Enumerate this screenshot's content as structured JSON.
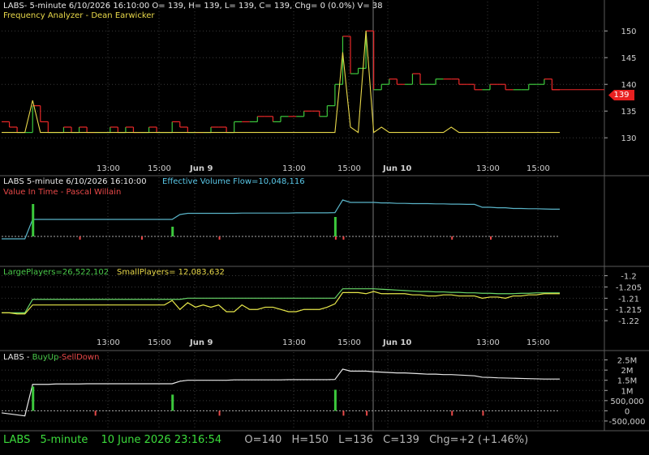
{
  "window": {
    "panel1_header": "LABS- 5-minute 6/10/2026 16:10:00 O= 139, H= 139, L= 139, C= 139, Chg= 0 (0.0%) V= 38",
    "panel1_indicator": "Frequency Analyzer - Dean Earwicker",
    "panel2_header": "LABS 5-minute  6/10/2026 16:10:00",
    "panel2_flow": "Effective Volume Flow=10,048,116",
    "panel2_indicator": "Value In Time - Pascal Willain",
    "panel3_large": "LargePlayers=26,522,102",
    "panel3_small": "SmallPlayers= 12,083,632",
    "panel4_symbol": "LABS - ",
    "panel4_buy": "BuyUp",
    "panel4_dash": "-",
    "panel4_sell": "SellDown",
    "price_tag": "139"
  },
  "footer": {
    "symbol": "LABS",
    "interval": "5-minute",
    "datetime": "10 June 2026 23:16:54",
    "open": "O=140",
    "high": "H=150",
    "low": "L=136",
    "close": "C=139",
    "change": "Chg=+2 (+1.46%)"
  },
  "colors": {
    "price_up": "#3cc83c",
    "price_down": "#e82828",
    "frequency": "#e8d84a",
    "evf_line": "#5ab4c8",
    "large_players": "#6ad86a",
    "small_players": "#e8e84a",
    "white_line": "#e8e8e8"
  },
  "chart_data": [
    {
      "type": "line",
      "panel": "price",
      "ylim": [
        127,
        152
      ],
      "y_ticks": [
        "130",
        "135",
        "140",
        "145",
        "150"
      ],
      "x_ticks": [
        "13:00",
        "15:00",
        "Jun 9",
        "13:00",
        "15:00",
        "Jun 10",
        "13:00",
        "15:00"
      ],
      "current_price": 139,
      "series": [
        {
          "values": [
            133,
            132,
            131,
            131,
            136,
            133,
            131,
            131,
            132,
            131,
            132,
            131,
            131,
            131,
            132,
            131,
            132,
            131,
            131,
            132,
            131,
            131,
            133,
            132,
            131,
            131,
            131,
            132,
            132,
            131,
            133,
            133,
            133,
            134,
            134,
            133,
            134,
            134,
            134,
            135,
            135,
            134,
            136,
            140,
            149,
            142,
            143,
            150,
            139,
            140,
            141,
            140,
            140,
            142,
            140,
            140,
            141,
            141,
            141,
            140,
            140,
            139,
            139,
            140,
            140,
            139,
            139,
            139,
            140,
            140,
            141,
            139,
            139
          ]
        },
        {
          "values": [
            131,
            131,
            131,
            131,
            137,
            131,
            131,
            131,
            131,
            131,
            131,
            131,
            131,
            131,
            131,
            131,
            131,
            131,
            131,
            131,
            131,
            131,
            131,
            131,
            131,
            131,
            131,
            131,
            131,
            131,
            131,
            131,
            131,
            131,
            131,
            131,
            131,
            131,
            131,
            131,
            131,
            131,
            131,
            131,
            146,
            132,
            131,
            150,
            131,
            132,
            131,
            131,
            131,
            131,
            131,
            131,
            131,
            131,
            132,
            131,
            131,
            131,
            131,
            131,
            131,
            131,
            131,
            131,
            131,
            131,
            131,
            131,
            131
          ]
        }
      ]
    },
    {
      "type": "line",
      "panel": "effective-volume-flow",
      "series": [
        {
          "values": [
            -1,
            -1,
            -1,
            -1,
            7,
            7,
            7,
            7,
            7,
            7,
            7,
            7,
            7,
            7,
            7,
            7,
            7,
            7,
            7,
            7,
            7,
            7,
            7,
            9,
            9.5,
            9.5,
            9.5,
            9.5,
            9.5,
            9.5,
            9.5,
            9.6,
            9.6,
            9.6,
            9.6,
            9.6,
            9.6,
            9.6,
            9.7,
            9.7,
            9.7,
            9.7,
            9.7,
            9.8,
            15,
            14,
            14,
            14,
            14,
            13.8,
            13.8,
            13.6,
            13.6,
            13.5,
            13.5,
            13.5,
            13.4,
            13.4,
            13.3,
            13.3,
            13.2,
            13.2,
            12,
            12,
            11.8,
            11.8,
            11.5,
            11.5,
            11.4,
            11.4,
            11.3,
            11.2,
            11.2
          ]
        }
      ]
    },
    {
      "type": "line",
      "panel": "players",
      "ylim": [
        -1.225,
        -1.198
      ],
      "y_ticks": [
        "-1.2",
        "-1.205",
        "-1.21",
        "-1.215",
        "-1.22"
      ],
      "x_ticks": [
        "13:00",
        "15:00",
        "Jun 9",
        "13:00",
        "15:00",
        "Jun 10",
        "13:00",
        "15:00"
      ],
      "series": [
        {
          "values": [
            -1.2165,
            -1.2165,
            -1.2165,
            -1.2165,
            -1.2105,
            -1.2105,
            -1.2105,
            -1.2105,
            -1.2105,
            -1.2105,
            -1.2105,
            -1.2105,
            -1.2105,
            -1.2105,
            -1.2105,
            -1.2105,
            -1.2105,
            -1.2105,
            -1.2105,
            -1.2105,
            -1.2105,
            -1.2105,
            -1.2105,
            -1.2105,
            -1.21,
            -1.21,
            -1.21,
            -1.21,
            -1.21,
            -1.21,
            -1.21,
            -1.21,
            -1.21,
            -1.21,
            -1.21,
            -1.21,
            -1.21,
            -1.21,
            -1.21,
            -1.21,
            -1.21,
            -1.21,
            -1.21,
            -1.21,
            -1.2058,
            -1.2058,
            -1.2058,
            -1.2058,
            -1.2058,
            -1.206,
            -1.2062,
            -1.2064,
            -1.2066,
            -1.2068,
            -1.207,
            -1.207,
            -1.2072,
            -1.2072,
            -1.2074,
            -1.2074,
            -1.2076,
            -1.2076,
            -1.2078,
            -1.2078,
            -1.208,
            -1.208,
            -1.208,
            -1.2078,
            -1.2078,
            -1.2076,
            -1.2076,
            -1.2076,
            -1.2076
          ]
        },
        {
          "values": [
            -1.2165,
            -1.2165,
            -1.217,
            -1.217,
            -1.213,
            -1.213,
            -1.213,
            -1.213,
            -1.213,
            -1.213,
            -1.213,
            -1.213,
            -1.213,
            -1.213,
            -1.213,
            -1.213,
            -1.213,
            -1.213,
            -1.213,
            -1.213,
            -1.213,
            -1.213,
            -1.211,
            -1.215,
            -1.212,
            -1.214,
            -1.213,
            -1.214,
            -1.213,
            -1.216,
            -1.216,
            -1.213,
            -1.215,
            -1.215,
            -1.214,
            -1.214,
            -1.215,
            -1.216,
            -1.216,
            -1.215,
            -1.215,
            -1.215,
            -1.214,
            -1.2125,
            -1.2075,
            -1.2075,
            -1.2075,
            -1.208,
            -1.207,
            -1.208,
            -1.208,
            -1.208,
            -1.208,
            -1.2085,
            -1.2085,
            -1.209,
            -1.209,
            -1.2085,
            -1.2085,
            -1.209,
            -1.209,
            -1.209,
            -1.21,
            -1.2095,
            -1.2095,
            -1.21,
            -1.209,
            -1.209,
            -1.2085,
            -1.2085,
            -1.208,
            -1.208,
            -1.208
          ]
        }
      ]
    },
    {
      "type": "bar",
      "panel": "buyup-selldown",
      "ylim": [
        -700000,
        3000000
      ],
      "y_ticks": [
        "2.5M",
        "2M",
        "1.5M",
        "1M",
        "500,000",
        "0",
        "-500,000"
      ],
      "series": [
        {
          "values": [
            -100000,
            -150000,
            -200000,
            -250000,
            1300000,
            1300000,
            1300000,
            1320000,
            1320000,
            1320000,
            1320000,
            1330000,
            1330000,
            1330000,
            1330000,
            1330000,
            1330000,
            1330000,
            1330000,
            1330000,
            1330000,
            1330000,
            1330000,
            1450000,
            1500000,
            1500000,
            1500000,
            1500000,
            1500000,
            1500000,
            1520000,
            1520000,
            1520000,
            1520000,
            1520000,
            1520000,
            1520000,
            1530000,
            1530000,
            1530000,
            1530000,
            1530000,
            1530000,
            1540000,
            2050000,
            1950000,
            1950000,
            1950000,
            1920000,
            1900000,
            1880000,
            1860000,
            1860000,
            1840000,
            1820000,
            1800000,
            1800000,
            1780000,
            1780000,
            1760000,
            1740000,
            1720000,
            1650000,
            1640000,
            1620000,
            1610000,
            1600000,
            1590000,
            1580000,
            1570000,
            1560000,
            1560000,
            1560000
          ]
        }
      ]
    }
  ]
}
